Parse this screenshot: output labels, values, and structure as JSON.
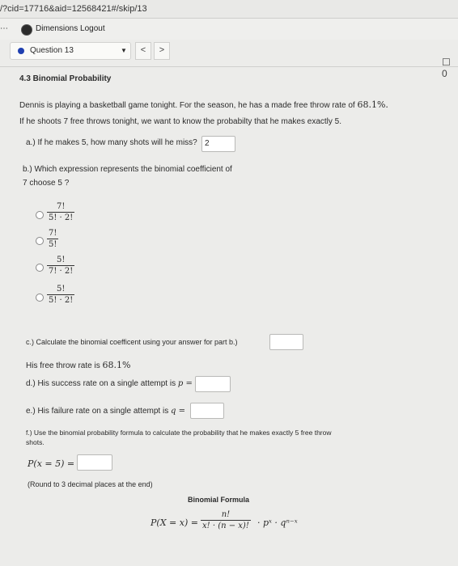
{
  "browser": {
    "url": "/?cid=17716&aid=12568421#/skip/13",
    "ellipsis": "⋯",
    "bookmark": "Dimensions Logout"
  },
  "nav": {
    "question_label": "Question 13",
    "caret": "▼",
    "prev": "<",
    "next": ">",
    "tool": "☐ 0"
  },
  "question": {
    "section": "4.3 Binomial Probability",
    "intro1": "Dennis is playing a basketball game tonight. For the season, he has a made free throw rate of ",
    "rate": "68.1%.",
    "intro2": "If he shoots 7 free throws tonight, we want to know the probabilty that he makes exactly 5.",
    "a_label": "a.) If he makes 5, how many shots will he miss?",
    "a_value": "2",
    "b_label": "b.) Which expression represents the binomial coefficient of",
    "b_label2": "7 choose 5 ?",
    "options": [
      {
        "num": "7!",
        "den": "5! · 2!"
      },
      {
        "num": "7!",
        "den": "5!"
      },
      {
        "num": "5!",
        "den": "7! · 2!"
      },
      {
        "num": "5!",
        "den": "5! · 2!"
      }
    ],
    "c_label": "c.) Calculate the binomial coefficent using your answer for part b.)",
    "c_value": "",
    "rate_text": "His free throw rate is ",
    "rate_value": "68.1%",
    "d_label": "d.) His success rate on a single attempt is ",
    "d_var": "p =",
    "d_value": "",
    "e_label": "e.) His failure rate on a single attempt is ",
    "e_var": "q =",
    "e_value": "",
    "f_label": "f.) Use the binomial probability formula to calculate the probability that he makes exactly 5 free throw",
    "f_label2": "shots.",
    "f_expr": "P(x = 5) =",
    "f_value": "",
    "round_note": "(Round to 3 decimal places at the end)",
    "formula_title": "Binomial Formula",
    "formula_lhs": "P(X = x) =",
    "formula_num": "n!",
    "formula_den": "x! · (n − x)!",
    "formula_rhs": "· pˣ · qⁿ⁻ˣ"
  }
}
